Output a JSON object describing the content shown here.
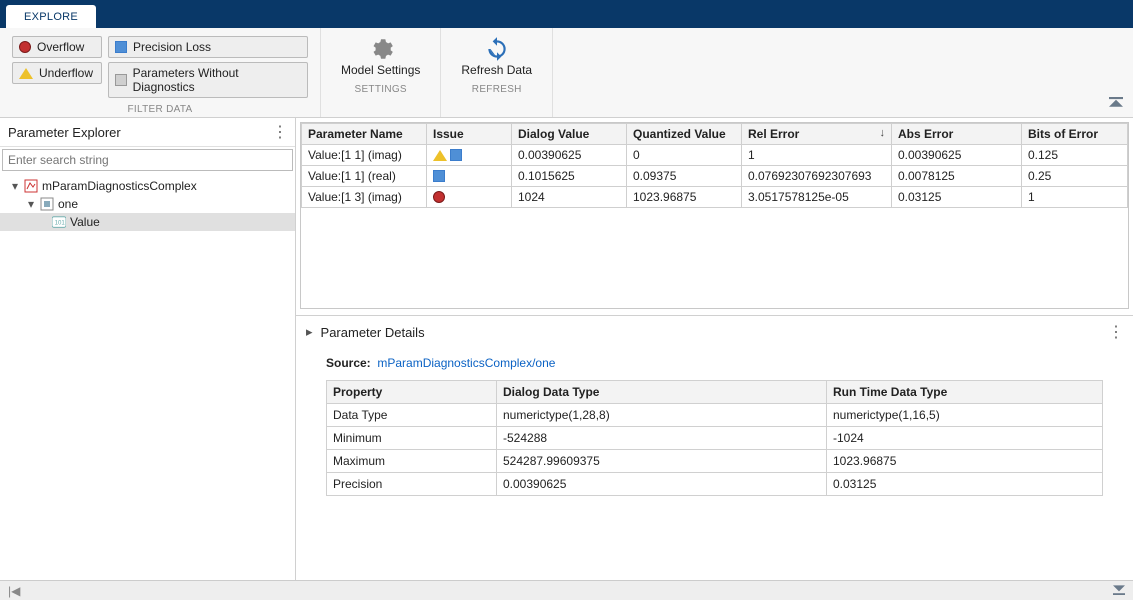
{
  "tab": {
    "explore": "EXPLORE"
  },
  "filters": {
    "overflow": "Overflow",
    "underflow": "Underflow",
    "precision_loss": "Precision Loss",
    "params_without": "Parameters Without Diagnostics",
    "section_label": "FILTER DATA"
  },
  "settings": {
    "btn": "Model Settings",
    "section": "SETTINGS"
  },
  "refresh": {
    "btn": "Refresh Data",
    "section": "REFRESH"
  },
  "sidebar": {
    "title": "Parameter Explorer",
    "search_placeholder": "Enter search string",
    "nodes": {
      "root": "mParamDiagnosticsComplex",
      "one": "one",
      "value": "Value"
    }
  },
  "grid": {
    "cols": {
      "param_name": "Parameter Name",
      "issue": "Issue",
      "dialog_value": "Dialog Value",
      "quant_value": "Quantized Value",
      "rel_error": "Rel Error",
      "abs_error": "Abs Error",
      "bits_error": "Bits of Error"
    },
    "rows": [
      {
        "param": "Value:[1 1] (imag)",
        "dialog": "0.00390625",
        "quant": "0",
        "rel": "1",
        "abs": "0.00390625",
        "bits": "0.125",
        "issue": [
          "triangle",
          "square"
        ]
      },
      {
        "param": "Value:[1 1] (real)",
        "dialog": "0.1015625",
        "quant": "0.09375",
        "rel": "0.07692307692307693",
        "abs": "0.0078125",
        "bits": "0.25",
        "issue": [
          "square"
        ]
      },
      {
        "param": "Value:[1 3] (imag)",
        "dialog": "1024",
        "quant": "1023.96875",
        "rel": "3.0517578125e-05",
        "abs": "0.03125",
        "bits": "1",
        "issue": [
          "circle"
        ]
      }
    ]
  },
  "details": {
    "title": "Parameter Details",
    "source_label": "Source:",
    "source_link": "mParamDiagnosticsComplex/one",
    "cols": {
      "prop": "Property",
      "dialog": "Dialog Data Type",
      "runtime": "Run Time Data Type"
    },
    "rows": [
      {
        "prop": "Data Type",
        "dialog": "numerictype(1,28,8)",
        "runtime": "numerictype(1,16,5)"
      },
      {
        "prop": "Minimum",
        "dialog": "-524288",
        "runtime": "-1024"
      },
      {
        "prop": "Maximum",
        "dialog": "524287.99609375",
        "runtime": "1023.96875"
      },
      {
        "prop": "Precision",
        "dialog": "0.00390625",
        "runtime": "0.03125"
      }
    ]
  },
  "colors": {
    "overflow": "#c23030",
    "underflow": "#edc12a",
    "precision": "#4f8fd6",
    "none": "#b0b0b0"
  }
}
